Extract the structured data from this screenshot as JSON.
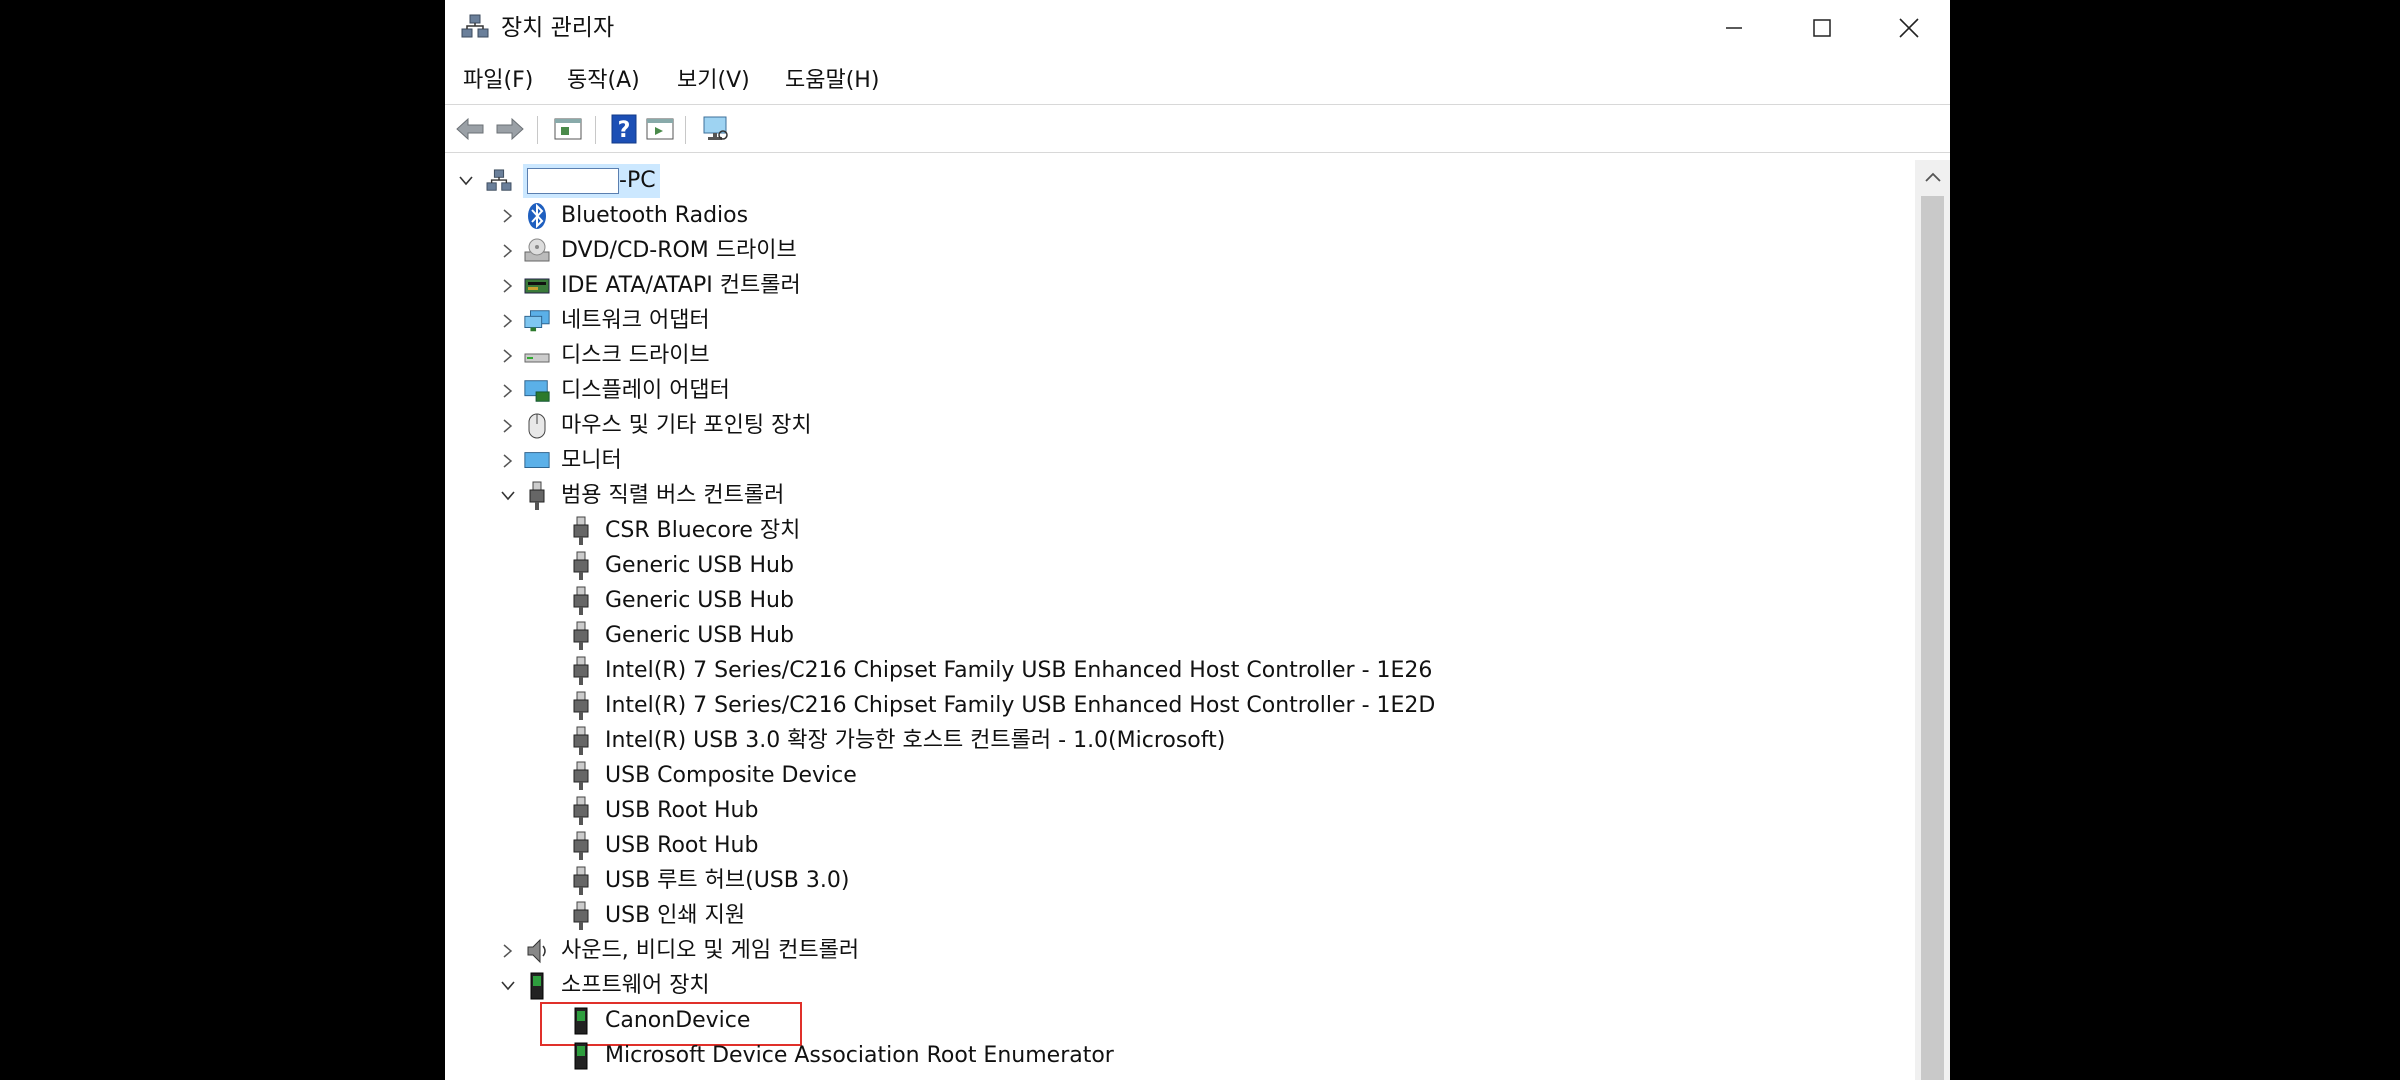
{
  "window": {
    "title": "장치 관리자"
  },
  "menu": [
    "파일(F)",
    "동작(A)",
    "보기(V)",
    "도움말(H)"
  ],
  "tree": {
    "root_label": "-PC",
    "categories": [
      {
        "label": "Bluetooth Radios",
        "icon": "bluetooth-icon"
      },
      {
        "label": "DVD/CD-ROM 드라이브",
        "icon": "dvd-drive-icon"
      },
      {
        "label": "IDE ATA/ATAPI 컨트롤러",
        "icon": "ide-controller-icon"
      },
      {
        "label": "네트워크 어댑터",
        "icon": "network-adapter-icon"
      },
      {
        "label": "디스크 드라이브",
        "icon": "disk-drive-icon"
      },
      {
        "label": "디스플레이 어댑터",
        "icon": "display-adapter-icon"
      },
      {
        "label": "마우스 및 기타 포인팅 장치",
        "icon": "mouse-icon"
      },
      {
        "label": "모니터",
        "icon": "monitor-icon"
      }
    ],
    "usb_category": "범용 직렬 버스 컨트롤러",
    "usb_devices": [
      "CSR Bluecore 장치",
      "Generic USB Hub",
      "Generic USB Hub",
      "Generic USB Hub",
      "Intel(R) 7 Series/C216 Chipset Family USB Enhanced Host Controller - 1E26",
      "Intel(R) 7 Series/C216 Chipset Family USB Enhanced Host Controller - 1E2D",
      "Intel(R) USB 3.0 확장 가능한 호스트 컨트롤러 - 1.0(Microsoft)",
      "USB Composite Device",
      "USB Root Hub",
      "USB Root Hub",
      "USB 루트 허브(USB 3.0)",
      "USB 인쇄 지원"
    ],
    "sound_category": "사운드, 비디오 및 게임 컨트롤러",
    "software_category": "소프트웨어 장치",
    "software_devices": [
      "CanonDevice",
      "Microsoft Device Association Root Enumerator"
    ]
  },
  "colors": {
    "selection": "#cce8ff",
    "highlight_box": "#e0302a"
  }
}
